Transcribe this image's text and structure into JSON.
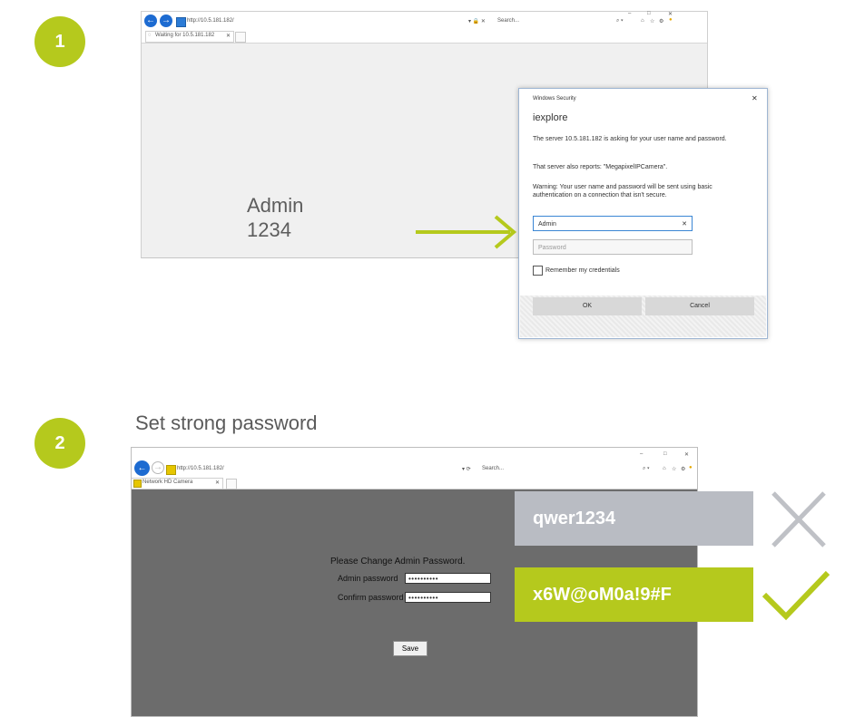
{
  "steps": [
    {
      "number": "1"
    },
    {
      "number": "2",
      "title": "Set strong password"
    }
  ],
  "browser1": {
    "url": "http://10.5.181.182/",
    "search": "Search...",
    "tab_title": "Waiting for 10.5.181.182",
    "window_controls": [
      "–",
      "□",
      "✕"
    ]
  },
  "overlay_credentials": {
    "username": "Admin",
    "password": "1234"
  },
  "security_dialog": {
    "title": "Windows Security",
    "app": "iexplore",
    "message": "The server 10.5.181.182 is asking for your user name and password.",
    "server_reports": "That server also reports: \"MegapixelIPCamera\".",
    "warning": "Warning: Your user name and password will be sent using basic authentication on a connection that isn't secure.",
    "username_value": "Admin",
    "password_placeholder": "Password",
    "remember_label": "Remember my credentials",
    "ok_label": "OK",
    "cancel_label": "Cancel"
  },
  "browser2": {
    "url": "http://10.5.181.182/",
    "search": "Search...",
    "tab_title": "Network HD Camera",
    "window_controls": [
      "–",
      "□",
      "✕"
    ],
    "form_title": "Please Change Admin Password.",
    "admin_password_label": "Admin password",
    "confirm_password_label": "Confirm password",
    "admin_password_value": "••••••••••",
    "confirm_password_value": "••••••••••",
    "save_label": "Save"
  },
  "password_examples": {
    "weak": "qwer1234",
    "strong": "x6W@oM0a!9#F"
  },
  "colors": {
    "accent": "#b5c91d",
    "weak_card": "#b9bcc3",
    "cross": "#bfc1c6"
  }
}
